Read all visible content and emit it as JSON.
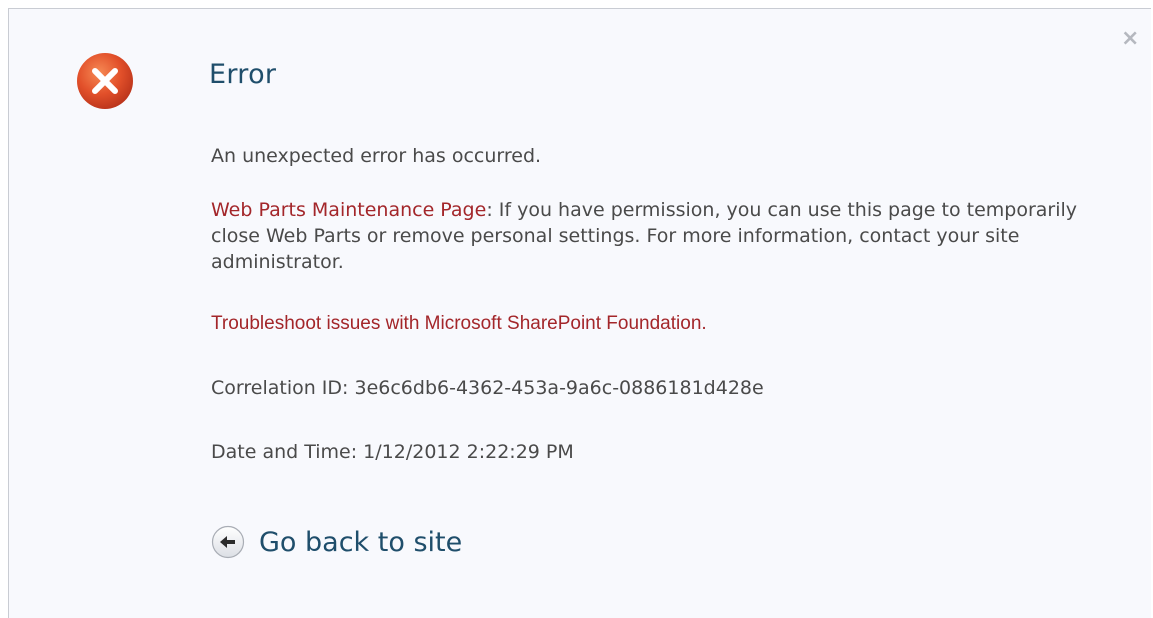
{
  "dialog": {
    "close_glyph": "×",
    "title": "Error",
    "message": "An unexpected error has occurred.",
    "maintenance_link": "Web Parts Maintenance Page",
    "maintenance_text": ": If you have permission, you can use this page to temporarily close Web Parts or remove personal settings. For more information, contact your site administrator.",
    "troubleshoot_link": "Troubleshoot issues with Microsoft SharePoint Foundation.",
    "correlation": "Correlation ID: 3e6c6db6-4362-453a-9a6c-0886181d428e",
    "datetime": "Date and Time: 1/12/2012 2:22:29 PM",
    "back_label": "Go back to site"
  },
  "icons": {
    "error": "error-x-circle-icon",
    "back": "back-arrow-circle-icon",
    "close": "close-icon"
  },
  "colors": {
    "accent_blue": "#1f4e6b",
    "link_red": "#a3262a",
    "error_orange": "#e2502a",
    "text_gray": "#4a4a4a"
  }
}
